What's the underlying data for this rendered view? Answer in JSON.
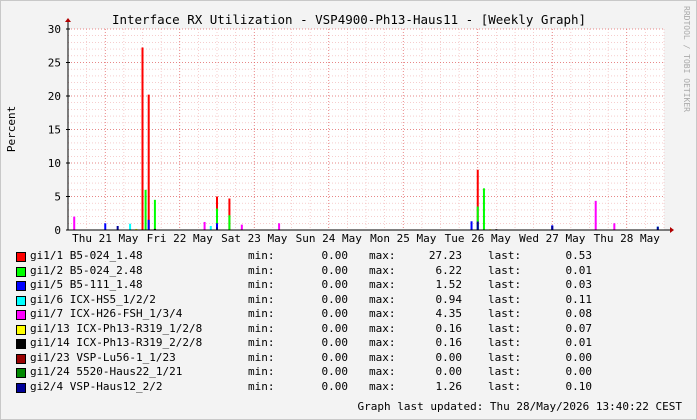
{
  "chart_data": {
    "type": "line",
    "title": "Interface RX Utilization - VSP4900-Ph13-Haus11 - [Weekly Graph]",
    "ylabel": "Percent",
    "ylim": [
      0,
      30
    ],
    "yticks": [
      0,
      5,
      10,
      15,
      20,
      25,
      30
    ],
    "xlim": [
      "2026-05-20 12:00",
      "2026-05-28 12:00"
    ],
    "xticks": [
      "Thu 21 May",
      "Fri 22 May",
      "Sat 23 May",
      "Sun 24 May",
      "Mon 25 May",
      "Tue 26 May",
      "Wed 27 May",
      "Thu 28 May"
    ],
    "grid": true,
    "watermark": "RRDTOOL / TOBI OETIKER",
    "series": [
      {
        "name": "gi1/1 B5-024_1.48",
        "color": "#ff0000",
        "points": [
          [
            "2026-05-21 12:00",
            27.23
          ],
          [
            "2026-05-21 14:00",
            20.2
          ],
          [
            "2026-05-22 12:00",
            5.0
          ],
          [
            "2026-05-22 16:00",
            4.7
          ],
          [
            "2026-05-26 00:00",
            9.0
          ]
        ]
      },
      {
        "name": "gi1/2 B5-024_2.48",
        "color": "#00ff00",
        "points": [
          [
            "2026-05-21 13:00",
            6.0
          ],
          [
            "2026-05-21 16:00",
            4.5
          ],
          [
            "2026-05-22 12:00",
            3.2
          ],
          [
            "2026-05-22 16:00",
            2.2
          ],
          [
            "2026-05-26 00:00",
            3.5
          ],
          [
            "2026-05-26 02:00",
            6.22
          ]
        ]
      },
      {
        "name": "gi1/5 B5-111_1.48",
        "color": "#0000ff",
        "points": [
          [
            "2026-05-21 00:00",
            1.0
          ],
          [
            "2026-05-21 14:00",
            1.52
          ],
          [
            "2026-05-22 12:00",
            1.0
          ],
          [
            "2026-05-25 22:00",
            1.3
          ],
          [
            "2026-05-27 00:00",
            0.7
          ]
        ]
      },
      {
        "name": "gi1/6 ICX-HS5_1/2/2",
        "color": "#00ffff",
        "points": [
          [
            "2026-05-21 08:00",
            0.94
          ],
          [
            "2026-05-22 10:00",
            0.6
          ],
          [
            "2026-05-26 00:00",
            0.6
          ],
          [
            "2026-05-28 10:00",
            0.5
          ]
        ]
      },
      {
        "name": "gi1/7 ICX-H26-FSH_1/3/4",
        "color": "#ff00ff",
        "points": [
          [
            "2026-05-20 14:00",
            2.0
          ],
          [
            "2026-05-22 08:00",
            1.2
          ],
          [
            "2026-05-22 20:00",
            0.8
          ],
          [
            "2026-05-23 08:00",
            1.0
          ],
          [
            "2026-05-27 14:00",
            4.35
          ],
          [
            "2026-05-27 20:00",
            1.0
          ]
        ]
      },
      {
        "name": "gi1/13 ICX-Ph13-R319_1/2/8",
        "color": "#ffff00",
        "points": [
          [
            "2026-05-21 10:00",
            0.16
          ],
          [
            "2026-05-26 04:00",
            0.12
          ]
        ]
      },
      {
        "name": "gi1/14 ICX-Ph13-R319_2/2/8",
        "color": "#000000",
        "points": [
          [
            "2026-05-21 16:00",
            0.16
          ],
          [
            "2026-05-26 06:00",
            0.12
          ]
        ]
      },
      {
        "name": "gi1/23 VSP-Lu56-1_1/23",
        "color": "#990000",
        "points": [
          [
            "2026-05-21 18:00",
            0.0
          ]
        ]
      },
      {
        "name": "gi1/24 5520-Haus22_1/21",
        "color": "#008800",
        "points": [
          [
            "2026-05-21 18:00",
            0.0
          ]
        ]
      },
      {
        "name": "gi2/4 VSP-Haus12_2/2",
        "color": "#000099",
        "points": [
          [
            "2026-05-21 04:00",
            0.6
          ],
          [
            "2026-05-22 12:00",
            0.4
          ],
          [
            "2026-05-26 00:00",
            1.26
          ],
          [
            "2026-05-27 00:00",
            0.6
          ],
          [
            "2026-05-28 10:00",
            0.5
          ]
        ]
      }
    ]
  },
  "legend": {
    "min_label": "min:",
    "max_label": "max:",
    "last_label": "last:",
    "rows": [
      {
        "name": "gi1/1 B5-024_1.48",
        "color": "#ff0000",
        "min": "0.00",
        "max": "27.23",
        "last": "0.53"
      },
      {
        "name": "gi1/2 B5-024_2.48",
        "color": "#00ff00",
        "min": "0.00",
        "max": "6.22",
        "last": "0.01"
      },
      {
        "name": "gi1/5 B5-111_1.48",
        "color": "#0000ff",
        "min": "0.00",
        "max": "1.52",
        "last": "0.03"
      },
      {
        "name": "gi1/6 ICX-HS5_1/2/2",
        "color": "#00ffff",
        "min": "0.00",
        "max": "0.94",
        "last": "0.11"
      },
      {
        "name": "gi1/7 ICX-H26-FSH_1/3/4",
        "color": "#ff00ff",
        "min": "0.00",
        "max": "4.35",
        "last": "0.08"
      },
      {
        "name": "gi1/13 ICX-Ph13-R319_1/2/8",
        "color": "#ffff00",
        "min": "0.00",
        "max": "0.16",
        "last": "0.07"
      },
      {
        "name": "gi1/14 ICX-Ph13-R319_2/2/8",
        "color": "#000000",
        "min": "0.00",
        "max": "0.16",
        "last": "0.01"
      },
      {
        "name": "gi1/23 VSP-Lu56-1_1/23",
        "color": "#990000",
        "min": "0.00",
        "max": "0.00",
        "last": "0.00"
      },
      {
        "name": "gi1/24 5520-Haus22_1/21",
        "color": "#008800",
        "min": "0.00",
        "max": "0.00",
        "last": "0.00"
      },
      {
        "name": "gi2/4 VSP-Haus12_2/2",
        "color": "#000099",
        "min": "0.00",
        "max": "1.26",
        "last": "0.10"
      }
    ]
  },
  "footer": {
    "updated": "Graph last updated: Thu 28/May/2026 13:40:22 CEST"
  }
}
